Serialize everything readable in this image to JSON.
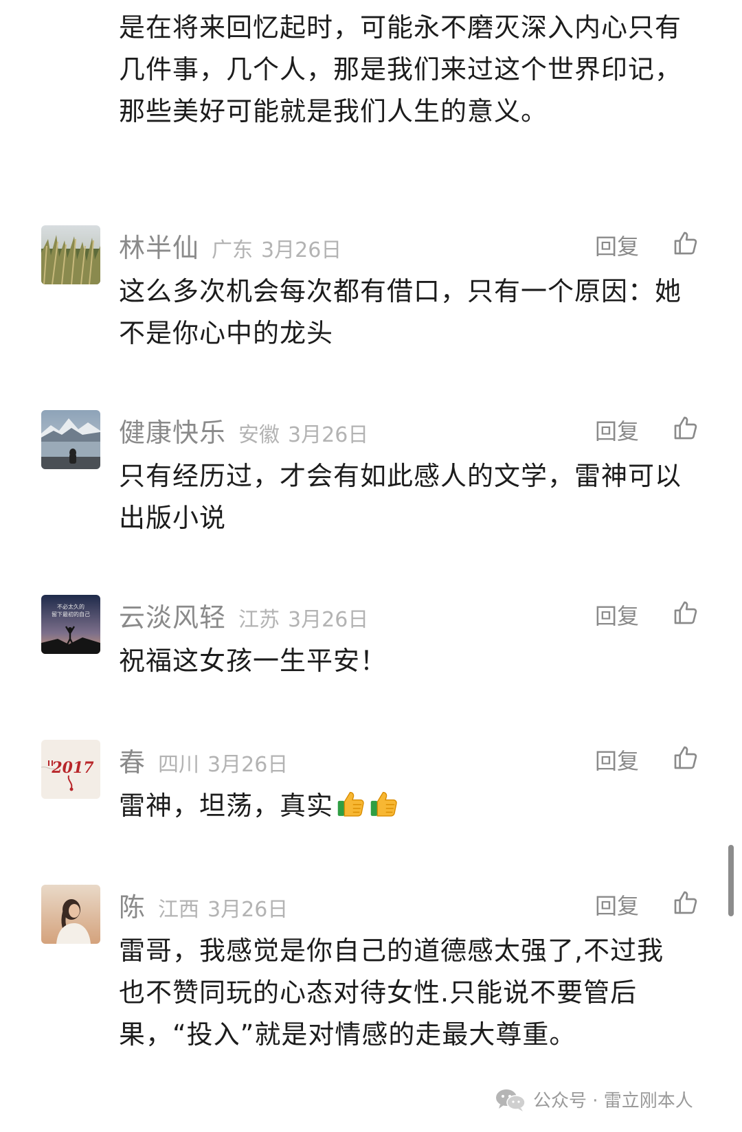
{
  "top_comment_tail": "是在将来回忆起时，可能永不磨灭深入内心只有几件事，几个人，那是我们来过这个世界印记，那些美好可能就是我们人生的意义。",
  "reply_label": "回复",
  "comments": [
    {
      "nickname": "林半仙",
      "region": "广东",
      "date": "3月26日",
      "text": "这么多次机会每次都有借口，只有一个原因：她不是你心中的龙头"
    },
    {
      "nickname": "健康快乐",
      "region": "安徽",
      "date": "3月26日",
      "text": "只有经历过，才会有如此感人的文学，雷神可以出版小说"
    },
    {
      "nickname": "云淡风轻",
      "region": "江苏",
      "date": "3月26日",
      "text": "祝福这女孩一生平安！"
    },
    {
      "nickname": "春",
      "region": "四川",
      "date": "3月26日",
      "text": "雷神，坦荡，真实"
    },
    {
      "nickname": "陈",
      "region": "江西",
      "date": "3月26日",
      "text": "雷哥，我感觉是你自己的道德感太强了,不过我也不赞同玩的心态对待女性.只能说不要管后果，“投入”就是对情感的走最大尊重。"
    }
  ],
  "avatar_texts": {
    "yun_line1": "不必太久的",
    "yun_line2": "留下最初的自己",
    "chun": "2017"
  },
  "watermark": "公众号 · 雷立刚本人",
  "icons": {
    "like": "thumbs-up-outline-icon",
    "emoji": "thumbs-up-emoji-icon",
    "watermark": "wechat-icon"
  },
  "colors": {
    "text": "#1c1c1c",
    "nickname": "#8a8a8a",
    "meta": "#b3b3b3",
    "scrollbar": "#8c8c8c"
  }
}
